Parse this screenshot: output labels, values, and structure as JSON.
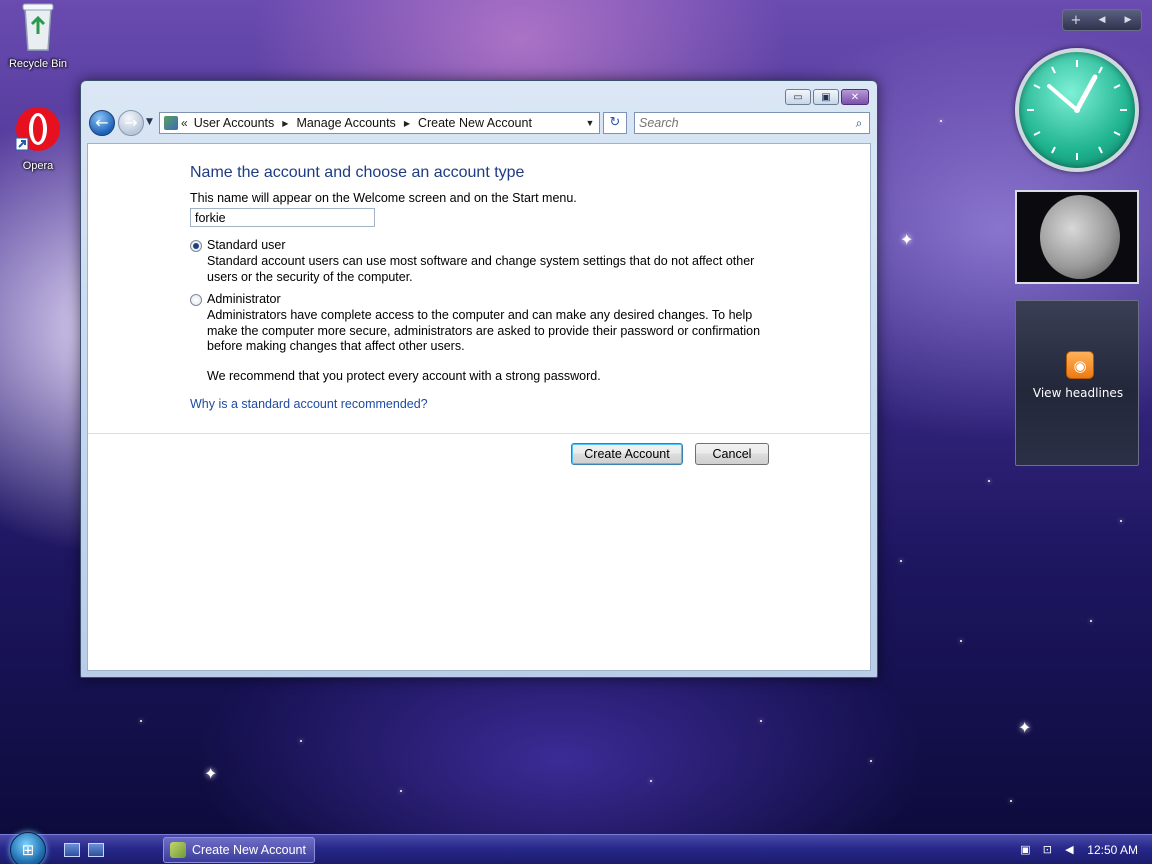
{
  "desktop": {
    "icons": [
      {
        "label": "Recycle Bin"
      },
      {
        "label": "Opera"
      }
    ]
  },
  "window": {
    "controls": {
      "minimize": "▭",
      "maximize": "▣",
      "close": "✕"
    },
    "nav": {
      "back": "←",
      "forward": "→",
      "recent": "▼",
      "breadcrumb_prefix": "«",
      "breadcrumbs": [
        "User Accounts",
        "Manage Accounts",
        "Create New Account"
      ],
      "crumb_separator": "▶",
      "address_dropdown": "▼",
      "refresh": "↻",
      "search_placeholder": "Search",
      "search_icon": "⌕"
    },
    "content": {
      "heading": "Name the account and choose an account type",
      "description": "This name will appear on the Welcome screen and on the Start menu.",
      "account_name": "forkie",
      "options": [
        {
          "label": "Standard user",
          "description": "Standard account users can use most software and change system settings that do not affect other users or the security of the computer.",
          "selected": true
        },
        {
          "label": "Administrator",
          "description": "Administrators have complete access to the computer and can make any desired changes. To help make the computer more secure, administrators are asked to provide their password or confirmation before making changes that affect other users.",
          "selected": false
        }
      ],
      "recommendation": "We recommend that you protect every account with a strong password.",
      "help_link": "Why is a standard account recommended?",
      "create_button": "Create Account",
      "cancel_button": "Cancel"
    }
  },
  "sidebar": {
    "controls": {
      "add": "+",
      "prev": "◀",
      "next": "▶"
    },
    "feed_icon": "◉",
    "feed_label": "View headlines"
  },
  "taskbar": {
    "start_icon": "⊞",
    "task_title": "Create New Account",
    "time": "12:50 AM"
  },
  "colors": {
    "accent_heading": "#1e3c84",
    "link": "#1e4ba3",
    "taskbar": "#27288a",
    "clock_face": "#1fb38f"
  }
}
